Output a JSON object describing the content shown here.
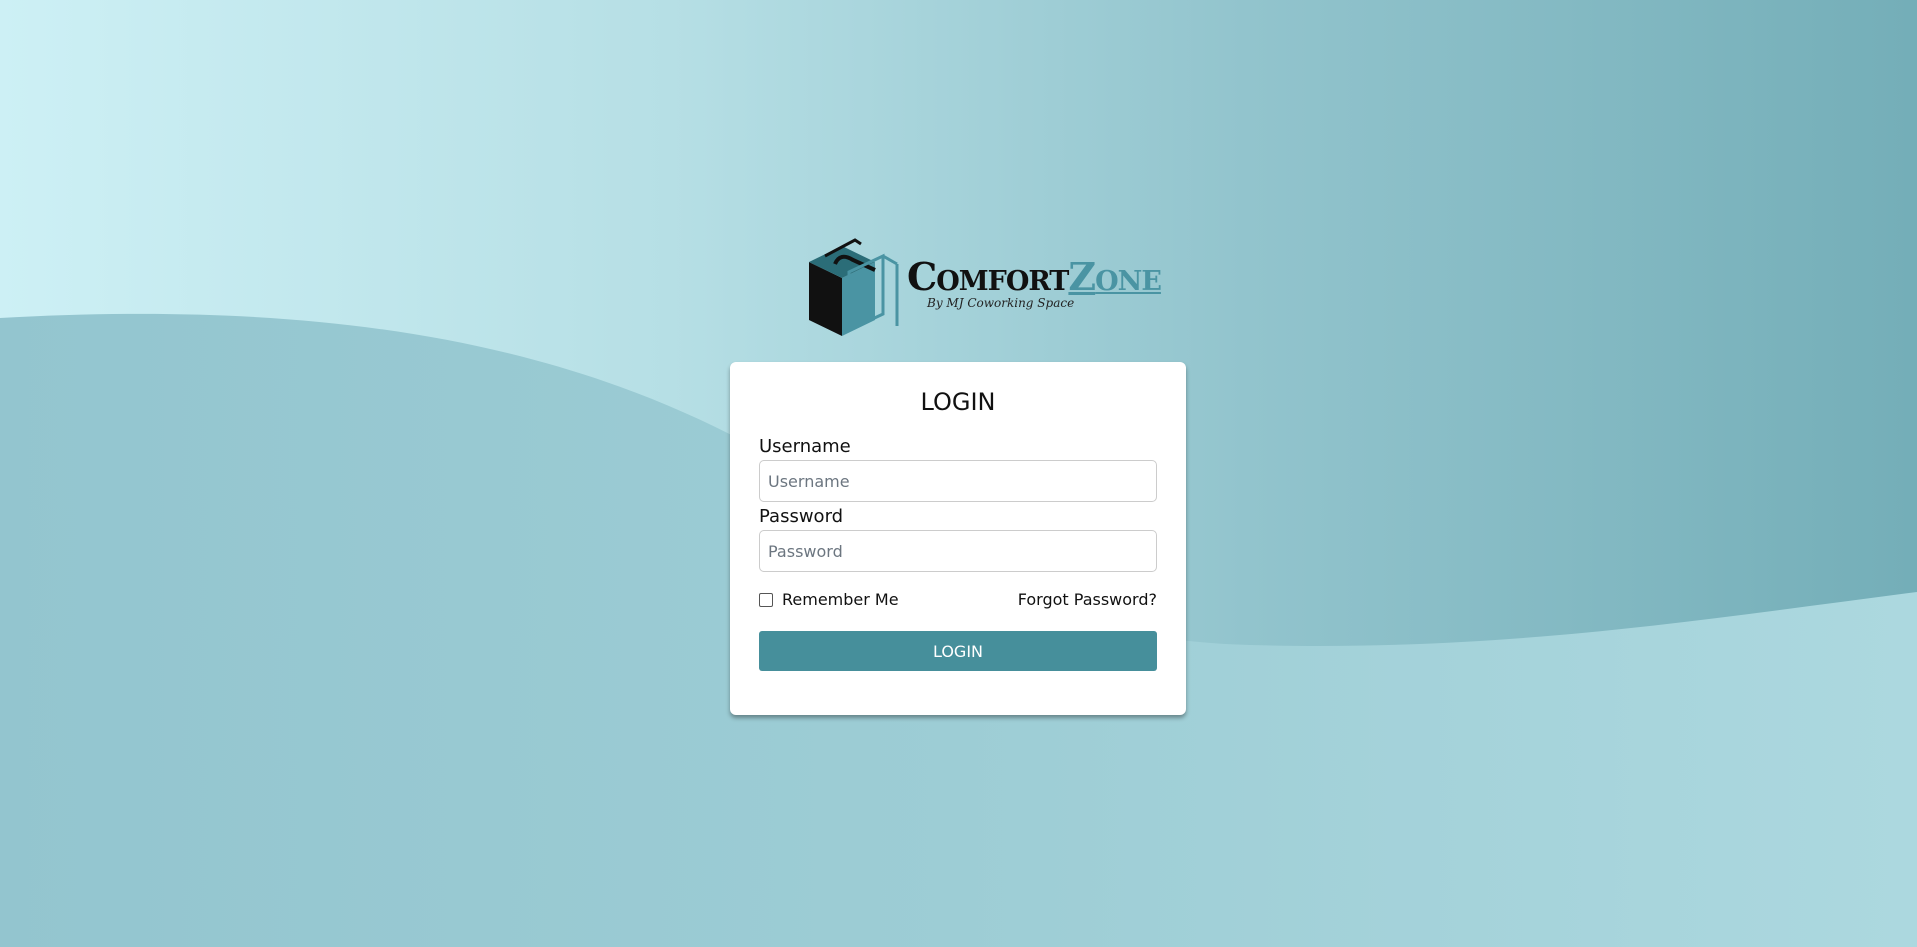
{
  "brand": {
    "logo_text_c": "C",
    "logo_text_omfort": "OMFORT",
    "logo_text_z": "Z",
    "logo_text_one": "ONE",
    "tagline": "By MJ Coworking Space",
    "accent_color": "#468f9b"
  },
  "login": {
    "title": "LOGIN",
    "username_label": "Username",
    "username_placeholder": "Username",
    "username_value": "",
    "password_label": "Password",
    "password_placeholder": "Password",
    "password_value": "",
    "remember_label": "Remember Me",
    "remember_checked": false,
    "forgot_label": "Forgot Password?",
    "submit_label": "LOGIN"
  }
}
